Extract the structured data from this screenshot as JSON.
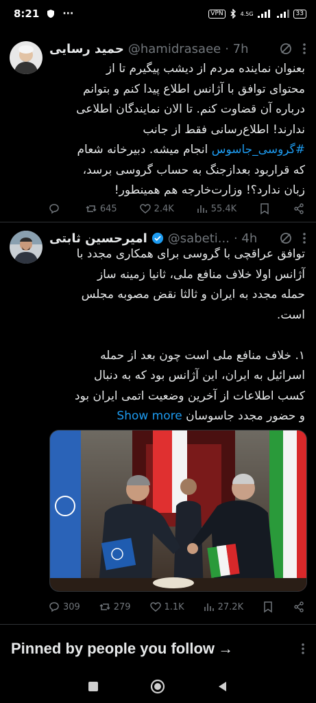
{
  "status_bar": {
    "time": "8:21",
    "dots": "···",
    "vpn": "VPN",
    "network": "4.5G",
    "battery": "33"
  },
  "tweets": [
    {
      "name": "حمید رسایی",
      "handle": "@hamidrasaee",
      "time": "· 7h",
      "verified": false,
      "text_lines": [
        "بعنوان نماینده مردم از دیشب پیگیرم تا از",
        "محتوای توافق با آژانس اطلاع پیدا کنم و بتوانم",
        "درباره آن قضاوت کنم. تا الان نمایندگان اطلاعی",
        "ندارند! اطلاع‌رسانی فقط از جانب"
      ],
      "hashtag": "#گروسی_جاسوس",
      "line5_rest": " انجام میشه. دبیرخانه شعام",
      "text_lines_after": [
        "که قراربود بعدازجنگ به حساب گروسی برسد،",
        "زبان ندارد؟! وزارت‌خارجه هم همینطور!"
      ],
      "stats": {
        "replies": "",
        "reposts": "645",
        "likes": "2.4K",
        "views": "55.4K"
      }
    },
    {
      "name": "امیرحسین ثابتی",
      "handle": "@sabeti...",
      "time": "· 4h",
      "verified": true,
      "text_lines": [
        "توافق عراقچی با گروسی برای همکاری مجدد با",
        "آژانس اولا خلاف منافع ملی، ثانیا زمینه ساز",
        "حمله مجدد به ایران و ثالثا نقض مصوبه مجلس",
        "است.",
        "",
        "۱. خلاف منافع ملی است چون بعد از حمله",
        "اسرائیل به ایران، این آژانس بود که به دنبال",
        "کسب اطلاعات از آخرین وضعیت اتمی ایران بود"
      ],
      "last_line": "و حضور مجدد جاسوسان",
      "show_more": "Show more",
      "stats": {
        "replies": "309",
        "reposts": "279",
        "likes": "1.1K",
        "views": "27.2K"
      }
    }
  ],
  "pinned": {
    "title": "Pinned by people you follow",
    "arrow": "→"
  },
  "colors": {
    "background": "#000000",
    "text": "#e7e9ea",
    "muted": "#71767b",
    "accent": "#1d9bf0",
    "divider": "#2f3336"
  }
}
